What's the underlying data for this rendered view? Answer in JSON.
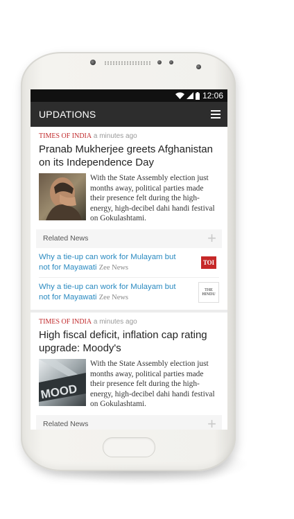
{
  "status": {
    "time": "12:06"
  },
  "app": {
    "title": "UPDATIONS"
  },
  "articles": [
    {
      "source": "TIMES OF INDIA",
      "time_ago": "a minutes ago",
      "headline": "Pranab Mukherjee greets Afghanistan on its Independence Day",
      "snippet": "With the State Assembly election just months away, political parties made their presence felt during the high-energy, high-decibel dahi handi festival on Gokulashtami.",
      "related_label": "Related News",
      "related": [
        {
          "title": "Why a tie-up can work for Mulayam but not for Mayawati",
          "source": "Zee News",
          "logo_text": "TOI"
        },
        {
          "title": "Why a tie-up can work for Mulayam but not for Mayawati",
          "source": "Zee News",
          "logo_text_1": "THE",
          "logo_text_2": "HINDU"
        }
      ]
    },
    {
      "source": "TIMES OF INDIA",
      "time_ago": "a minutes ago",
      "headline": "High fiscal deficit, inflation cap rating upgrade: Moody's",
      "snippet": "With the State Assembly election just months away, political parties made their presence felt during the high-energy, high-decibel dahi handi festival on Gokulashtami.",
      "thumb_text": "MOOD",
      "related_label": "Related News"
    }
  ]
}
